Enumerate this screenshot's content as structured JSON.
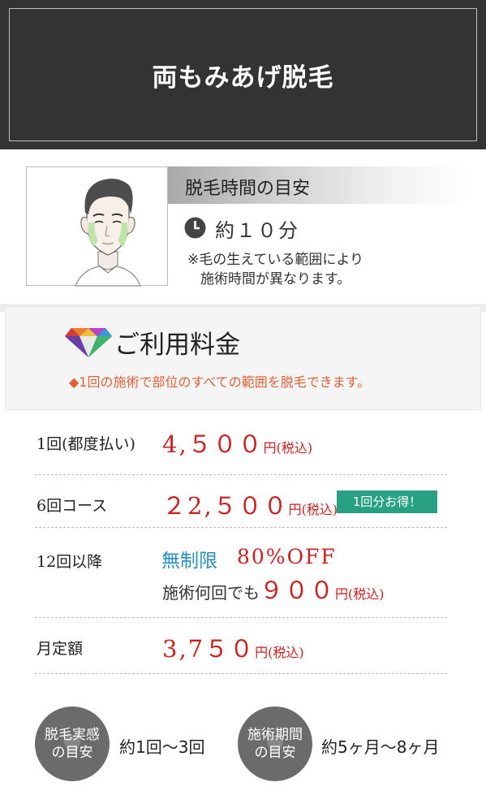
{
  "header": {
    "title": "両もみあげ脱毛"
  },
  "time": {
    "heading": "脱毛時間の目安",
    "value": "約１０分",
    "note_line1": "※毛の生えている範囲により",
    "note_line2": "施術時間が異なります。"
  },
  "price": {
    "heading": "ご利用料金",
    "note": "◆1回の施術で部位のすべての範囲を脱毛できます。",
    "rows": [
      {
        "label": "1回(都度払い)",
        "price": "4,５００",
        "unit": "円(税込)"
      },
      {
        "label": "6回コース",
        "price": "２2,５００",
        "unit": "円(税込)",
        "badge": "1回分お得！"
      },
      {
        "label": "12回以降",
        "unlimited": "無制限",
        "off": "80%OFF",
        "sub_prefix": "施術何回でも",
        "sub_price": "９００",
        "unit": "円(税込)"
      },
      {
        "label": "月定額",
        "price": "3,7５０",
        "unit": "円(税込)"
      }
    ]
  },
  "stats": [
    {
      "circle_line1": "脱毛実感",
      "circle_line2": "の目安",
      "value": "約1回〜3回"
    },
    {
      "circle_line1": "施術期間",
      "circle_line2": "の目安",
      "value": "約5ヶ月〜8ヶ月"
    }
  ],
  "colors": {
    "header_bg": "#333333",
    "price_red": "#cc1f1f",
    "note_orange": "#e06036",
    "badge_green": "#27a083",
    "unlimited_blue": "#2a8fc5",
    "circle_gray": "#6b6b6b"
  },
  "icons": {
    "face": "face-illustration-icon",
    "clock": "clock-icon",
    "diamond": "diamond-icon",
    "heart": "heart-icon"
  }
}
